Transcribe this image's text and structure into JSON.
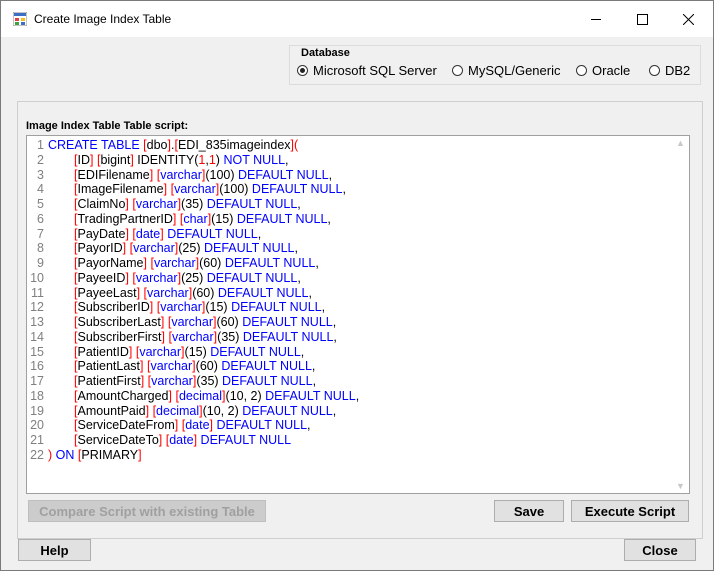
{
  "window": {
    "title": "Create Image Index Table"
  },
  "database": {
    "legend": "Database",
    "options": [
      {
        "label": "Microsoft SQL Server",
        "checked": true
      },
      {
        "label": "MySQL/Generic",
        "checked": false
      },
      {
        "label": "Oracle",
        "checked": false
      },
      {
        "label": "DB2",
        "checked": false
      }
    ]
  },
  "script": {
    "label": "Image Index Table Table script:",
    "lines": [
      [
        [
          "kw",
          "CREATE TABLE "
        ],
        [
          "br",
          "["
        ],
        [
          "id",
          "dbo"
        ],
        [
          "br",
          "]"
        ],
        [
          "id",
          "."
        ],
        [
          "br",
          "["
        ],
        [
          "id",
          "EDI_835imageindex"
        ],
        [
          "br",
          "]("
        ]
      ],
      [
        [
          "br",
          "["
        ],
        [
          "id",
          "ID"
        ],
        [
          "br",
          "]"
        ],
        [
          "id",
          " "
        ],
        [
          "br",
          "["
        ],
        [
          "id",
          "bigint"
        ],
        [
          "br",
          "]"
        ],
        [
          "id",
          " IDENTITY("
        ],
        [
          "br",
          "1"
        ],
        [
          "id",
          ","
        ],
        [
          "br",
          "1"
        ],
        [
          "id",
          ") "
        ],
        [
          "kw",
          "NOT NULL"
        ],
        [
          "id",
          ","
        ]
      ],
      [
        [
          "br",
          "["
        ],
        [
          "id",
          "EDIFilename"
        ],
        [
          "br",
          "]"
        ],
        [
          "id",
          " "
        ],
        [
          "br",
          "["
        ],
        [
          "kw",
          "varchar"
        ],
        [
          "br",
          "]"
        ],
        [
          "id",
          "(100) "
        ],
        [
          "kw",
          "DEFAULT NULL"
        ],
        [
          "id",
          ","
        ]
      ],
      [
        [
          "br",
          "["
        ],
        [
          "id",
          "ImageFilename"
        ],
        [
          "br",
          "]"
        ],
        [
          "id",
          " "
        ],
        [
          "br",
          "["
        ],
        [
          "kw",
          "varchar"
        ],
        [
          "br",
          "]"
        ],
        [
          "id",
          "(100) "
        ],
        [
          "kw",
          "DEFAULT NULL"
        ],
        [
          "id",
          ","
        ]
      ],
      [
        [
          "br",
          "["
        ],
        [
          "id",
          "ClaimNo"
        ],
        [
          "br",
          "]"
        ],
        [
          "id",
          " "
        ],
        [
          "br",
          "["
        ],
        [
          "kw",
          "varchar"
        ],
        [
          "br",
          "]"
        ],
        [
          "id",
          "(35) "
        ],
        [
          "kw",
          "DEFAULT NULL"
        ],
        [
          "id",
          ","
        ]
      ],
      [
        [
          "br",
          "["
        ],
        [
          "id",
          "TradingPartnerID"
        ],
        [
          "br",
          "]"
        ],
        [
          "id",
          " "
        ],
        [
          "br",
          "["
        ],
        [
          "kw",
          "char"
        ],
        [
          "br",
          "]"
        ],
        [
          "id",
          "(15) "
        ],
        [
          "kw",
          "DEFAULT NULL"
        ],
        [
          "id",
          ","
        ]
      ],
      [
        [
          "br",
          "["
        ],
        [
          "id",
          "PayDate"
        ],
        [
          "br",
          "]"
        ],
        [
          "id",
          " "
        ],
        [
          "br",
          "["
        ],
        [
          "kw",
          "date"
        ],
        [
          "br",
          "]"
        ],
        [
          "id",
          " "
        ],
        [
          "kw",
          "DEFAULT NULL"
        ],
        [
          "id",
          ","
        ]
      ],
      [
        [
          "br",
          "["
        ],
        [
          "id",
          "PayorID"
        ],
        [
          "br",
          "]"
        ],
        [
          "id",
          " "
        ],
        [
          "br",
          "["
        ],
        [
          "kw",
          "varchar"
        ],
        [
          "br",
          "]"
        ],
        [
          "id",
          "(25) "
        ],
        [
          "kw",
          "DEFAULT NULL"
        ],
        [
          "id",
          ","
        ]
      ],
      [
        [
          "br",
          "["
        ],
        [
          "id",
          "PayorName"
        ],
        [
          "br",
          "]"
        ],
        [
          "id",
          " "
        ],
        [
          "br",
          "["
        ],
        [
          "kw",
          "varchar"
        ],
        [
          "br",
          "]"
        ],
        [
          "id",
          "(60) "
        ],
        [
          "kw",
          "DEFAULT NULL"
        ],
        [
          "id",
          ","
        ]
      ],
      [
        [
          "br",
          "["
        ],
        [
          "id",
          "PayeeID"
        ],
        [
          "br",
          "]"
        ],
        [
          "id",
          " "
        ],
        [
          "br",
          "["
        ],
        [
          "kw",
          "varchar"
        ],
        [
          "br",
          "]"
        ],
        [
          "id",
          "(25) "
        ],
        [
          "kw",
          "DEFAULT NULL"
        ],
        [
          "id",
          ","
        ]
      ],
      [
        [
          "br",
          "["
        ],
        [
          "id",
          "PayeeLast"
        ],
        [
          "br",
          "]"
        ],
        [
          "id",
          " "
        ],
        [
          "br",
          "["
        ],
        [
          "kw",
          "varchar"
        ],
        [
          "br",
          "]"
        ],
        [
          "id",
          "(60) "
        ],
        [
          "kw",
          "DEFAULT NULL"
        ],
        [
          "id",
          ","
        ]
      ],
      [
        [
          "br",
          "["
        ],
        [
          "id",
          "SubscriberID"
        ],
        [
          "br",
          "]"
        ],
        [
          "id",
          " "
        ],
        [
          "br",
          "["
        ],
        [
          "kw",
          "varchar"
        ],
        [
          "br",
          "]"
        ],
        [
          "id",
          "(15) "
        ],
        [
          "kw",
          "DEFAULT NULL"
        ],
        [
          "id",
          ","
        ]
      ],
      [
        [
          "br",
          "["
        ],
        [
          "id",
          "SubscriberLast"
        ],
        [
          "br",
          "]"
        ],
        [
          "id",
          " "
        ],
        [
          "br",
          "["
        ],
        [
          "kw",
          "varchar"
        ],
        [
          "br",
          "]"
        ],
        [
          "id",
          "(60) "
        ],
        [
          "kw",
          "DEFAULT NULL"
        ],
        [
          "id",
          ","
        ]
      ],
      [
        [
          "br",
          "["
        ],
        [
          "id",
          "SubscriberFirst"
        ],
        [
          "br",
          "]"
        ],
        [
          "id",
          " "
        ],
        [
          "br",
          "["
        ],
        [
          "kw",
          "varchar"
        ],
        [
          "br",
          "]"
        ],
        [
          "id",
          "(35) "
        ],
        [
          "kw",
          "DEFAULT NULL"
        ],
        [
          "id",
          ","
        ]
      ],
      [
        [
          "br",
          "["
        ],
        [
          "id",
          "PatientID"
        ],
        [
          "br",
          "]"
        ],
        [
          "id",
          " "
        ],
        [
          "br",
          "["
        ],
        [
          "kw",
          "varchar"
        ],
        [
          "br",
          "]"
        ],
        [
          "id",
          "(15) "
        ],
        [
          "kw",
          "DEFAULT NULL"
        ],
        [
          "id",
          ","
        ]
      ],
      [
        [
          "br",
          "["
        ],
        [
          "id",
          "PatientLast"
        ],
        [
          "br",
          "]"
        ],
        [
          "id",
          " "
        ],
        [
          "br",
          "["
        ],
        [
          "kw",
          "varchar"
        ],
        [
          "br",
          "]"
        ],
        [
          "id",
          "(60) "
        ],
        [
          "kw",
          "DEFAULT NULL"
        ],
        [
          "id",
          ","
        ]
      ],
      [
        [
          "br",
          "["
        ],
        [
          "id",
          "PatientFirst"
        ],
        [
          "br",
          "]"
        ],
        [
          "id",
          " "
        ],
        [
          "br",
          "["
        ],
        [
          "kw",
          "varchar"
        ],
        [
          "br",
          "]"
        ],
        [
          "id",
          "(35) "
        ],
        [
          "kw",
          "DEFAULT NULL"
        ],
        [
          "id",
          ","
        ]
      ],
      [
        [
          "br",
          "["
        ],
        [
          "id",
          "AmountCharged"
        ],
        [
          "br",
          "]"
        ],
        [
          "id",
          " "
        ],
        [
          "br",
          "["
        ],
        [
          "kw",
          "decimal"
        ],
        [
          "br",
          "]"
        ],
        [
          "id",
          "(10, 2) "
        ],
        [
          "kw",
          "DEFAULT NULL"
        ],
        [
          "id",
          ","
        ]
      ],
      [
        [
          "br",
          "["
        ],
        [
          "id",
          "AmountPaid"
        ],
        [
          "br",
          "]"
        ],
        [
          "id",
          " "
        ],
        [
          "br",
          "["
        ],
        [
          "kw",
          "decimal"
        ],
        [
          "br",
          "]"
        ],
        [
          "id",
          "(10, 2) "
        ],
        [
          "kw",
          "DEFAULT NULL"
        ],
        [
          "id",
          ","
        ]
      ],
      [
        [
          "br",
          "["
        ],
        [
          "id",
          "ServiceDateFrom"
        ],
        [
          "br",
          "]"
        ],
        [
          "id",
          " "
        ],
        [
          "br",
          "["
        ],
        [
          "kw",
          "date"
        ],
        [
          "br",
          "]"
        ],
        [
          "id",
          " "
        ],
        [
          "kw",
          "DEFAULT NULL"
        ],
        [
          "id",
          ","
        ]
      ],
      [
        [
          "br",
          "["
        ],
        [
          "id",
          "ServiceDateTo"
        ],
        [
          "br",
          "]"
        ],
        [
          "id",
          " "
        ],
        [
          "br",
          "["
        ],
        [
          "kw",
          "date"
        ],
        [
          "br",
          "]"
        ],
        [
          "id",
          " "
        ],
        [
          "kw",
          "DEFAULT NULL"
        ]
      ],
      [
        [
          "br",
          ")"
        ],
        [
          "id",
          " "
        ],
        [
          "kw",
          "ON"
        ],
        [
          "id",
          " "
        ],
        [
          "br",
          "["
        ],
        [
          "id",
          "PRIMARY"
        ],
        [
          "br",
          "]"
        ]
      ]
    ]
  },
  "buttons": {
    "compare": "Compare Script with existing Table",
    "save": "Save",
    "execute": "Execute Script",
    "help": "Help",
    "close": "Close"
  },
  "colors": {
    "keyword": "#0000ff",
    "bracket": "#ff0000"
  }
}
